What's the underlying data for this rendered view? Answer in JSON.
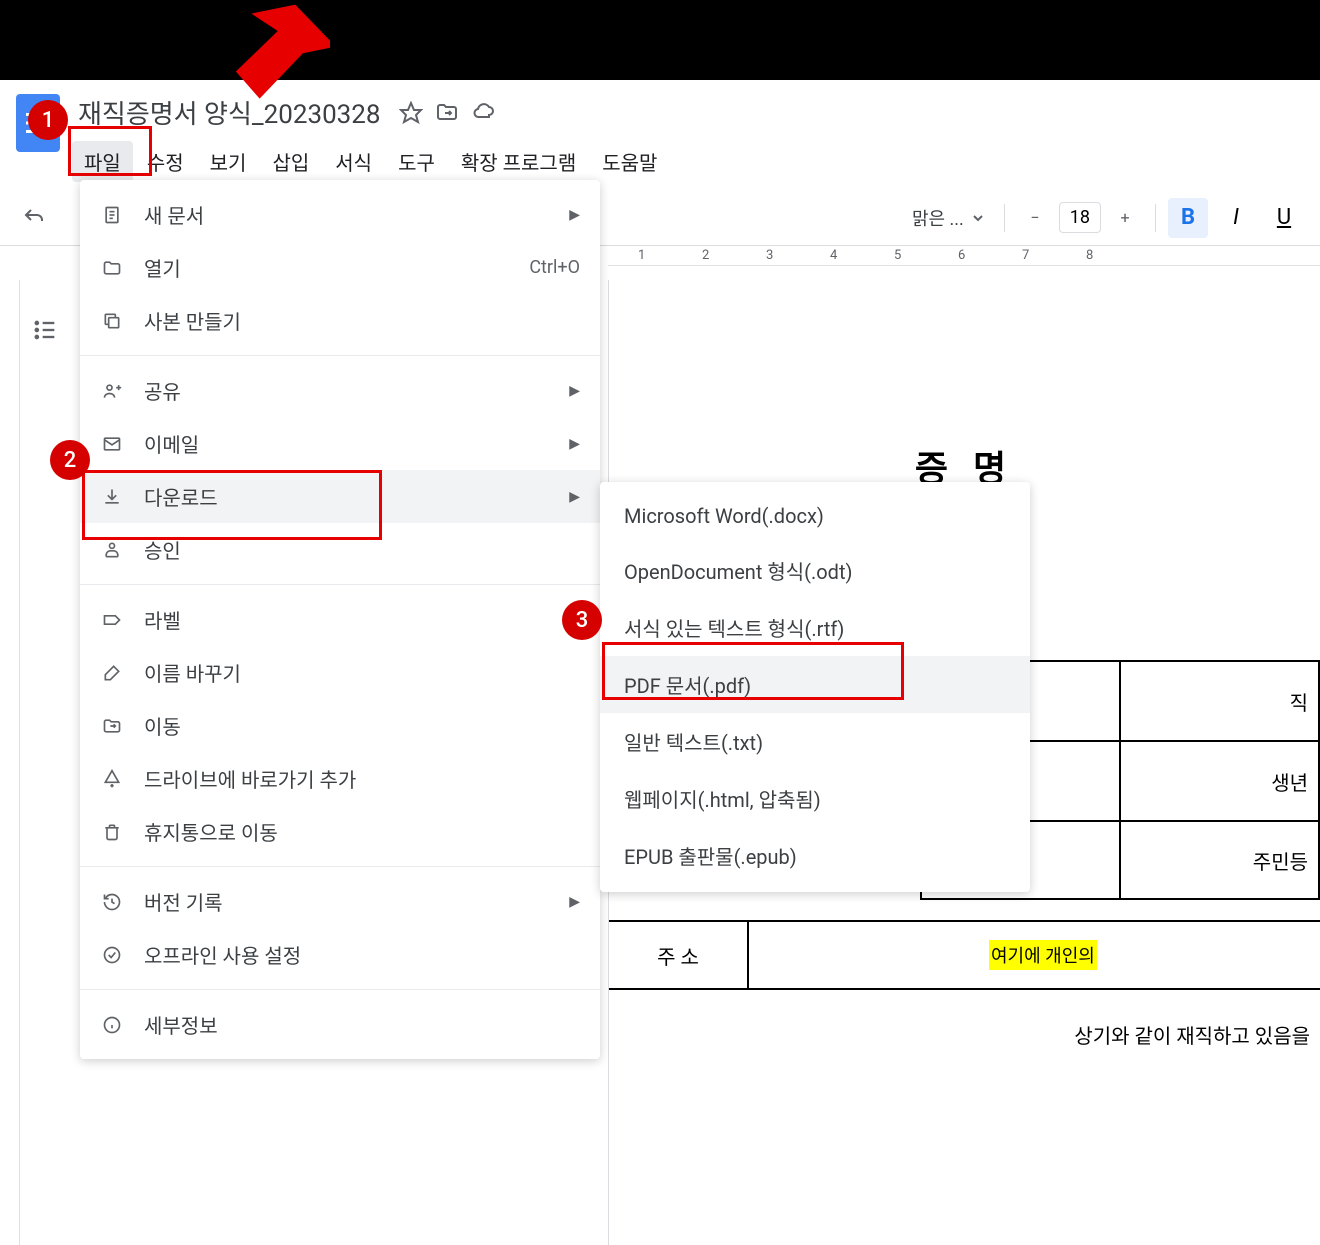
{
  "document": {
    "title": "재직증명서 양식_20230328"
  },
  "menubar": {
    "file": "파일",
    "edit": "수정",
    "view": "보기",
    "insert": "삽입",
    "format": "서식",
    "tools": "도구",
    "extensions": "확장 프로그램",
    "help": "도움말"
  },
  "toolbar": {
    "font_name": "맑은 ...",
    "font_size": "18"
  },
  "ruler": {
    "marks": [
      "1",
      "2",
      "3",
      "4",
      "5",
      "6",
      "7",
      "8"
    ]
  },
  "dropdown": {
    "new_doc": "새 문서",
    "open": "열기",
    "open_shortcut": "Ctrl+O",
    "make_copy": "사본 만들기",
    "share": "공유",
    "email": "이메일",
    "download": "다운로드",
    "approve": "승인",
    "label": "라벨",
    "rename": "이름 바꾸기",
    "move": "이동",
    "add_shortcut": "드라이브에 바로가기 추가",
    "trash": "휴지통으로 이동",
    "version_history": "버전 기록",
    "offline": "오프라인 사용 설정",
    "details": "세부정보"
  },
  "submenu": {
    "docx": "Microsoft Word(.docx)",
    "odt": "OpenDocument 형식(.odt)",
    "rtf": "서식 있는 텍스트 형식(.rtf)",
    "pdf": "PDF 문서(.pdf)",
    "txt": "일반 텍스트(.txt)",
    "html": "웹페이지(.html, 압축됨)",
    "epub": "EPUB 출판물(.epub)"
  },
  "docbody": {
    "heading": "증 명",
    "row1": "직",
    "row2": "생년",
    "row3": "주민등",
    "address_label": "주 소",
    "address_highlight": "여기에 개인의",
    "footer": "상기와 같이 재직하고 있음을"
  },
  "badges": {
    "b1": "1",
    "b2": "2",
    "b3": "3"
  }
}
